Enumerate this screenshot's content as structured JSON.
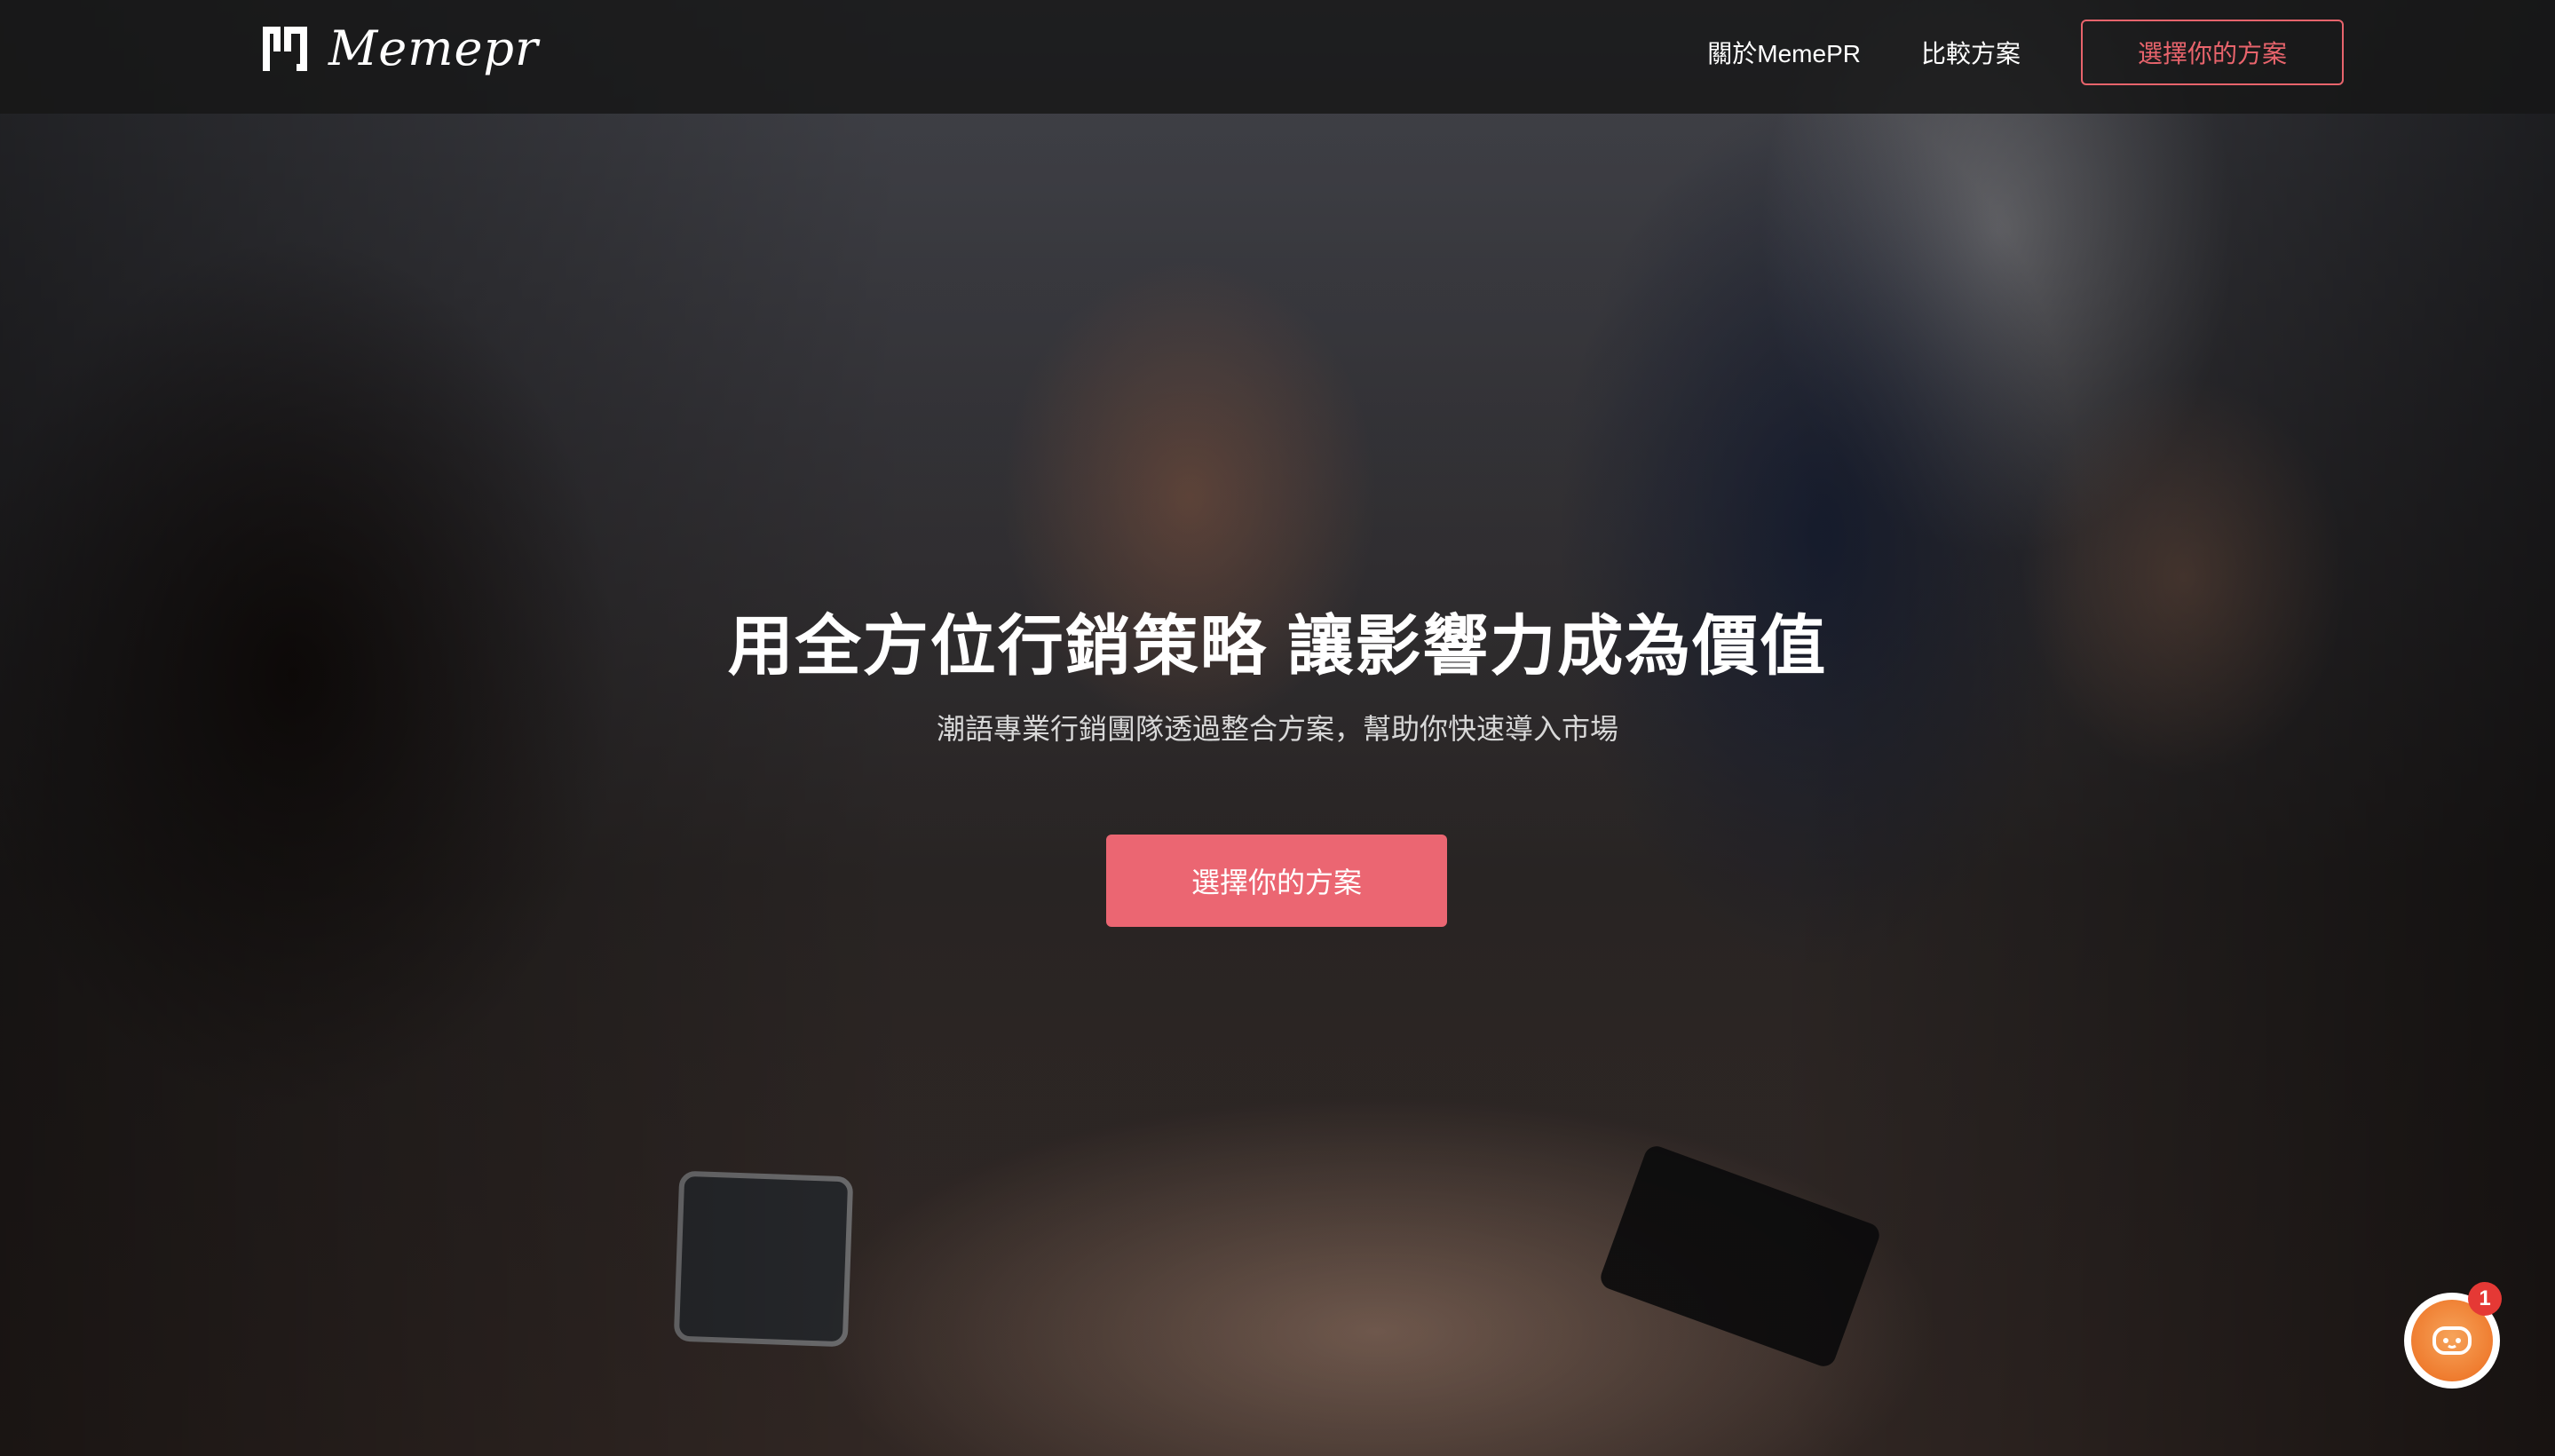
{
  "brand": {
    "logo_text": "Memepr",
    "accent_color": "#eb6672"
  },
  "nav": {
    "about": "關於MemePR",
    "compare": "比較方案",
    "cta": "選擇你的方案"
  },
  "hero": {
    "title": "用全方位行銷策略 讓影響力成為價值",
    "subtitle": "潮語專業行銷團隊透過整合方案，幫助你快速導入市場",
    "cta": "選擇你的方案"
  },
  "chat_widget": {
    "icon": "chat-bot-icon",
    "badge_count": "1",
    "color": "#ef7c2f"
  }
}
